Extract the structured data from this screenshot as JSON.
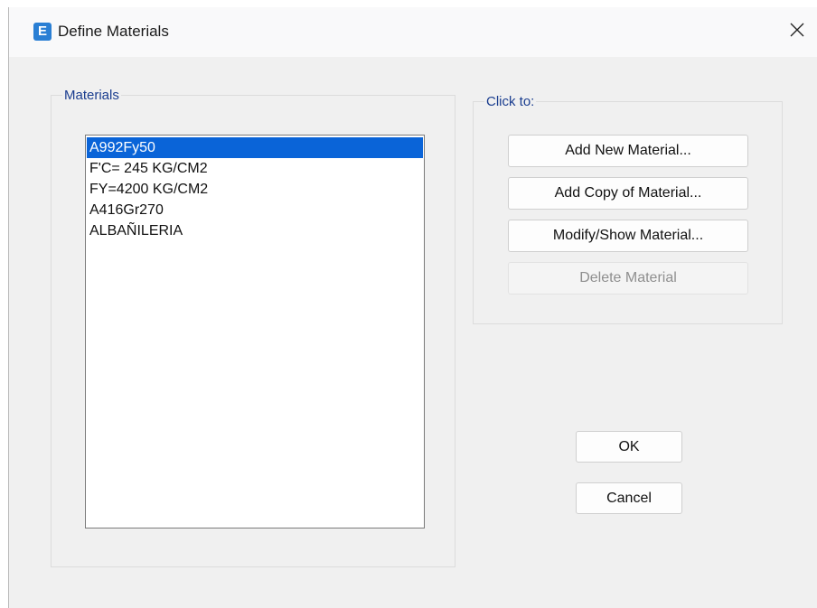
{
  "window": {
    "title": "Define Materials",
    "app_icon_letter": "E"
  },
  "materials_group": {
    "legend": "Materials",
    "items": [
      {
        "label": "A992Fy50",
        "selected": true
      },
      {
        "label": "F'C= 245 KG/CM2",
        "selected": false
      },
      {
        "label": "FY=4200 KG/CM2",
        "selected": false
      },
      {
        "label": "A416Gr270",
        "selected": false
      },
      {
        "label": "ALBAÑILERIA",
        "selected": false
      }
    ]
  },
  "actions_group": {
    "legend": "Click to:",
    "add_new": "Add New Material...",
    "add_copy": "Add Copy of Material...",
    "modify_show": "Modify/Show Material...",
    "delete": "Delete Material"
  },
  "footer": {
    "ok": "OK",
    "cancel": "Cancel"
  },
  "icons": {
    "app": "etabs-app-icon",
    "close": "close-icon"
  },
  "colors": {
    "selection": "#0a64d8",
    "legend_text": "#1a3d8f",
    "app_icon": "#2a7fd4"
  }
}
